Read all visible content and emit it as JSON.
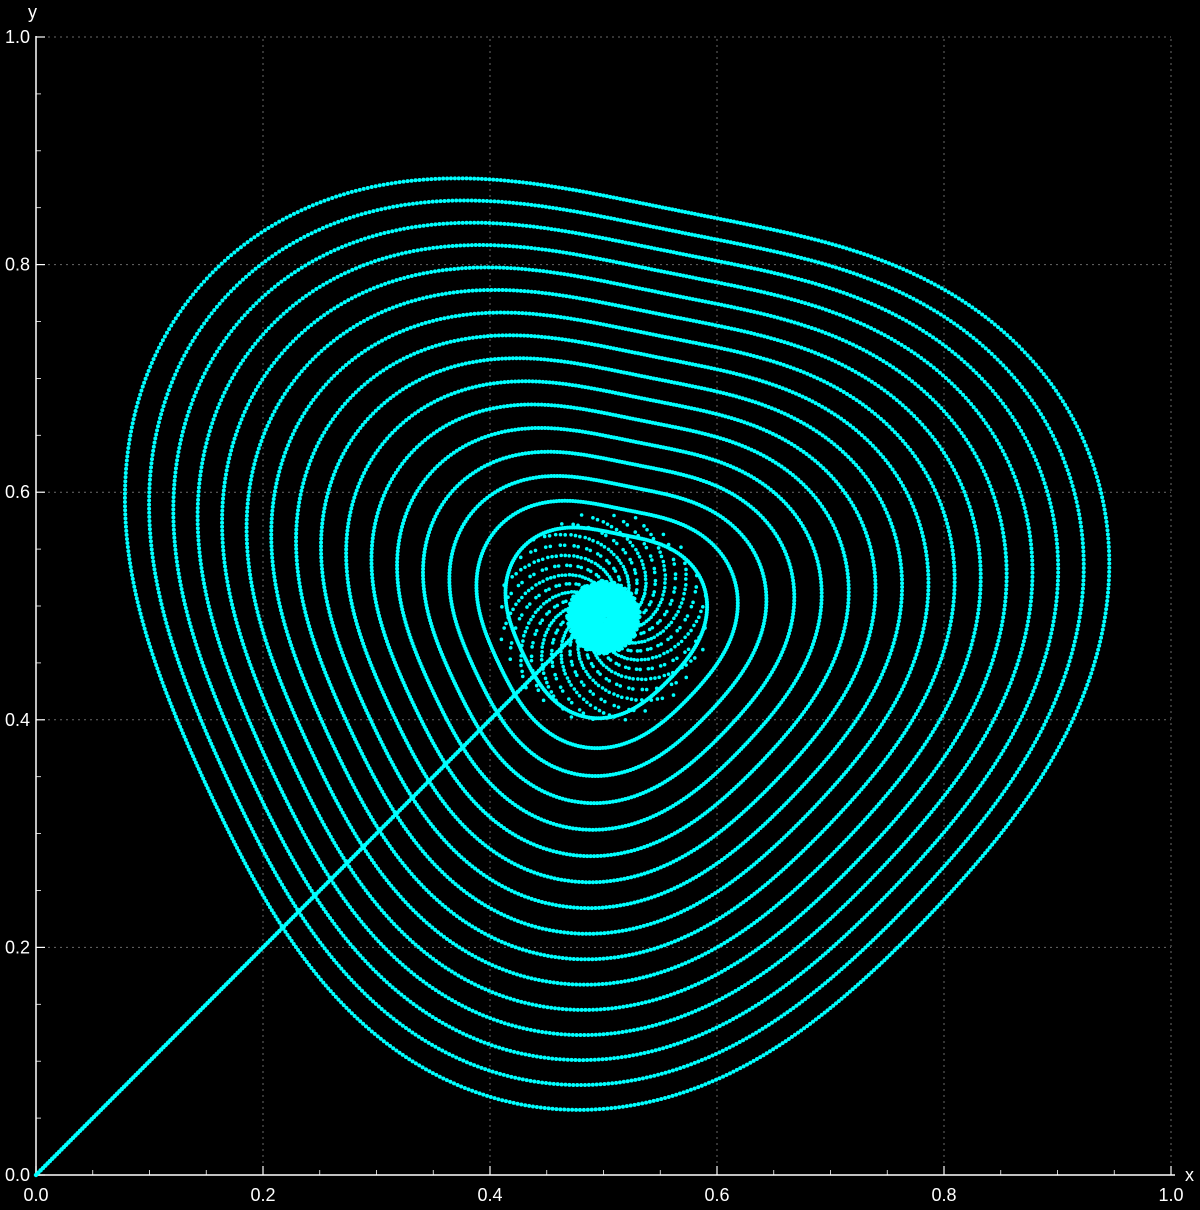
{
  "chart_data": {
    "type": "scatter",
    "title": "",
    "xlabel": "x",
    "ylabel": "y",
    "xlim": [
      0.0,
      1.0
    ],
    "ylim": [
      0.0,
      1.0
    ],
    "x_ticks": [
      "0.0",
      "0.2",
      "0.4",
      "0.6",
      "0.8",
      "1.0"
    ],
    "y_ticks": [
      "0.0",
      "0.2",
      "0.4",
      "0.6",
      "0.8",
      "1.0"
    ],
    "grid": true,
    "legend": "none",
    "colors": {
      "background": "#000000",
      "points": "#00ffff",
      "axes": "#ffffff",
      "grid": "#6a6a6a"
    },
    "series": [
      {
        "description_free_values": true,
        "diagonal_segment": {
          "x": [
            0.0,
            0.49
          ],
          "y": [
            0.0,
            0.49
          ]
        },
        "focus_point": {
          "x": 0.5,
          "y": 0.49
        },
        "outer_loop_extent": {
          "x": [
            0.08,
            0.895
          ],
          "y": [
            0.08,
            0.895
          ]
        },
        "loop_count": 16
      }
    ]
  }
}
